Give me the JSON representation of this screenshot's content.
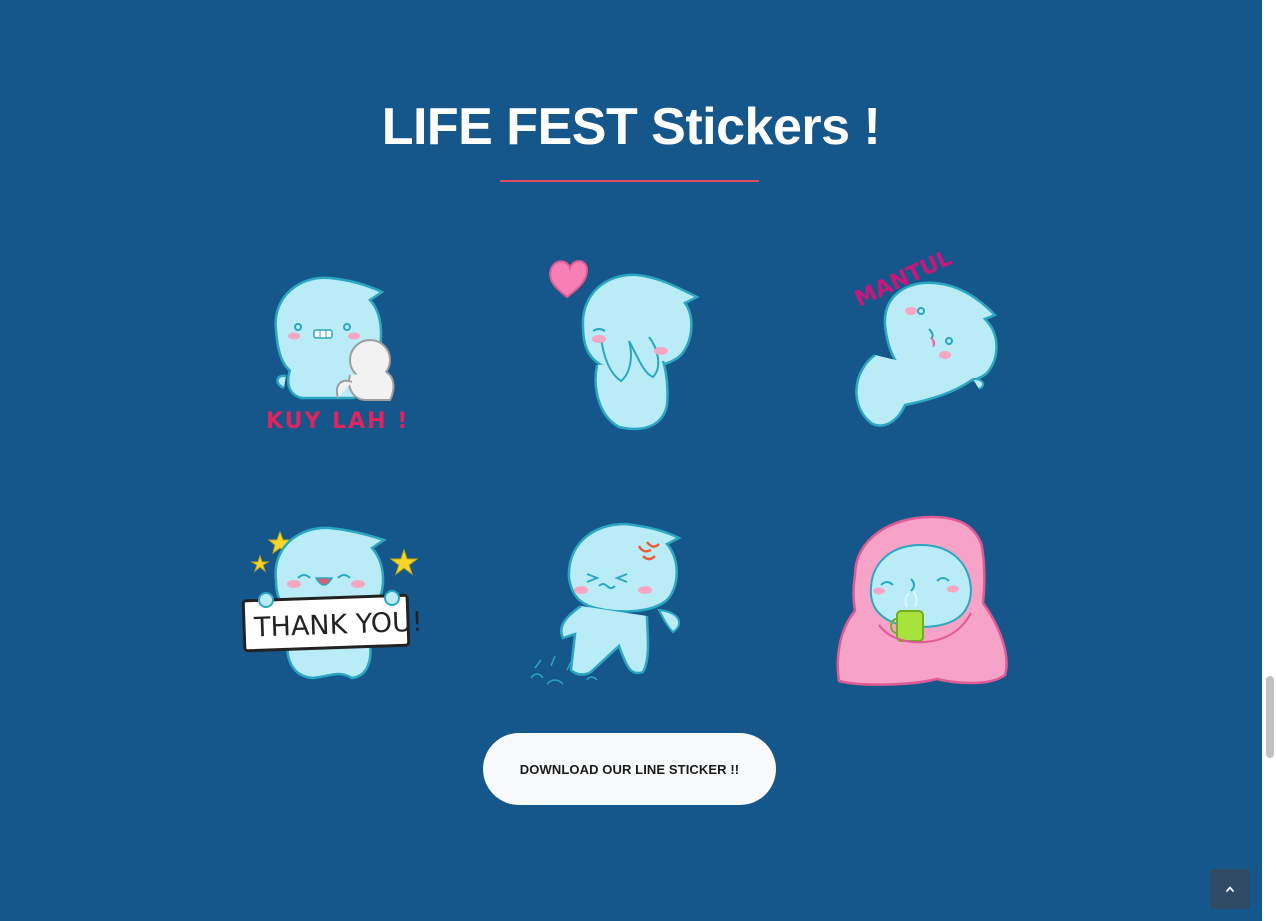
{
  "section": {
    "title": "LIFE FEST Stickers !",
    "background_color": "#16578b",
    "underline_color": "#e04c5b"
  },
  "stickers": [
    {
      "name": "kuy-lah-sticker",
      "caption": "KUY LAH !"
    },
    {
      "name": "love-sticker",
      "caption": ""
    },
    {
      "name": "mantul-sticker",
      "caption": "MANTUL"
    },
    {
      "name": "thank-you-sticker",
      "caption": "THANK YOU!"
    },
    {
      "name": "angry-sticker",
      "caption": ""
    },
    {
      "name": "blanket-sticker",
      "caption": ""
    }
  ],
  "download_button": {
    "label": "DOWNLOAD OUR LINE STICKER !!"
  },
  "back_to_top": {
    "icon": "chevron-up-icon"
  }
}
